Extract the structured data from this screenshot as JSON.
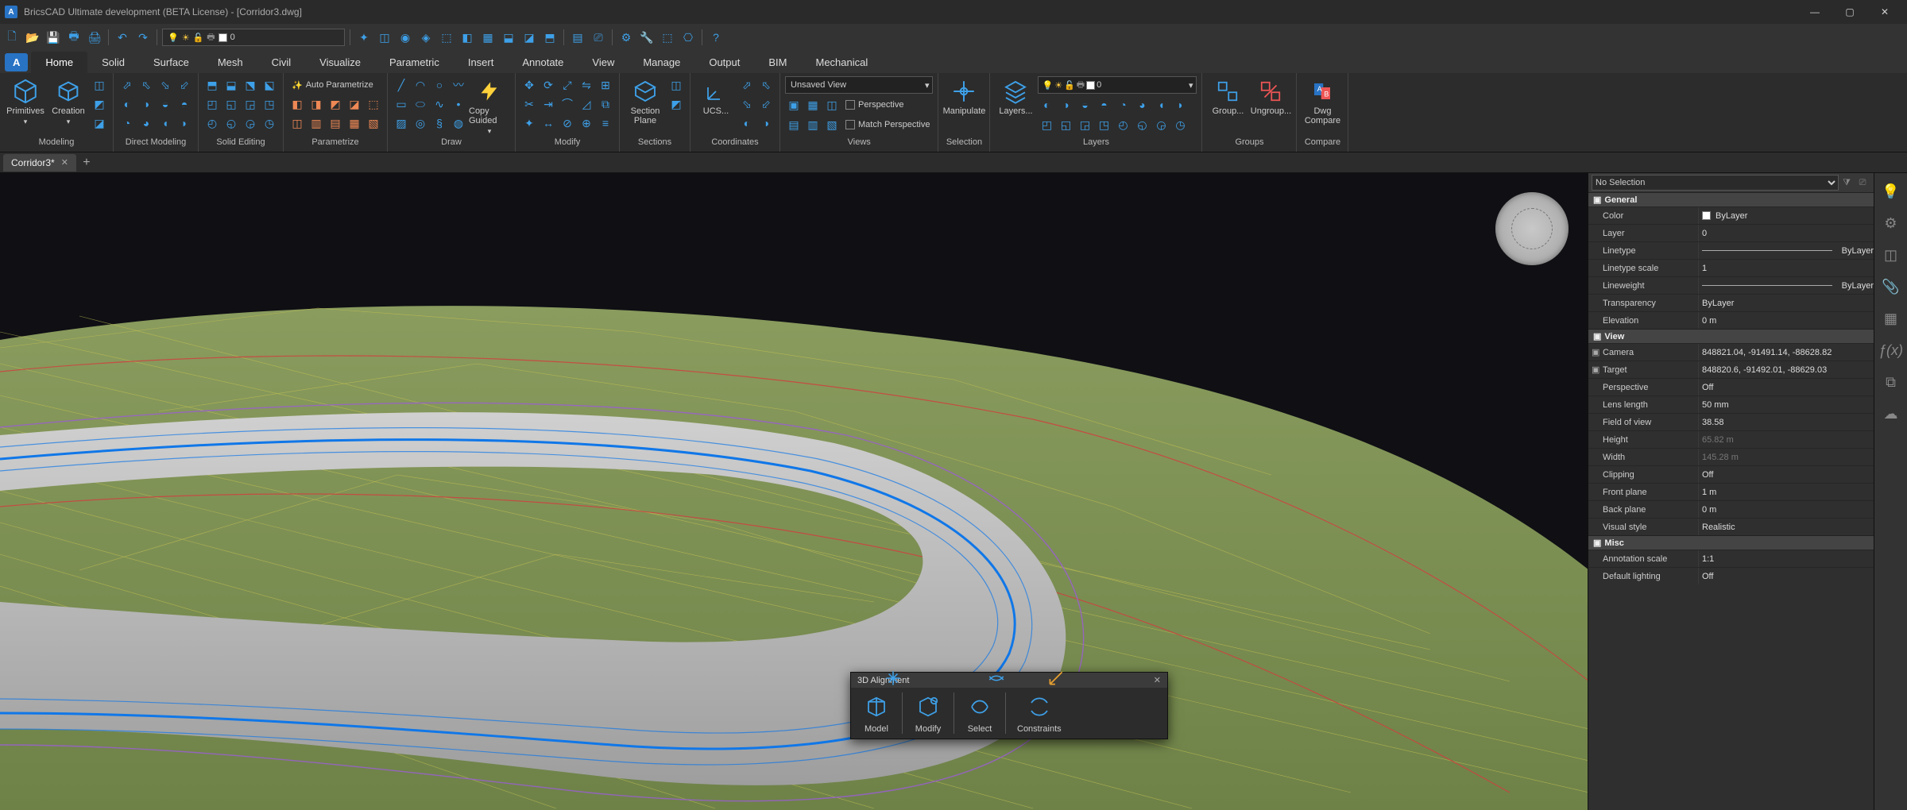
{
  "app": {
    "title": "BricsCAD Ultimate development (BETA License) - [Corridor3.dwg]"
  },
  "quickLayer": "0",
  "tabs": [
    "Home",
    "Solid",
    "Surface",
    "Mesh",
    "Civil",
    "Visualize",
    "Parametric",
    "Insert",
    "Annotate",
    "View",
    "Manage",
    "Output",
    "BIM",
    "Mechanical"
  ],
  "activeTab": "Home",
  "panels": {
    "modeling": {
      "label": "Modeling",
      "primitives": "Primitives",
      "creation": "Creation"
    },
    "directModeling": {
      "label": "Direct Modeling"
    },
    "solidEditing": {
      "label": "Solid Editing"
    },
    "parametrize": {
      "label": "Parametrize",
      "auto": "Auto Parametrize"
    },
    "draw": {
      "label": "Draw",
      "copyGuided": "Copy Guided"
    },
    "modify": {
      "label": "Modify"
    },
    "sections": {
      "label": "Sections",
      "sectionPlane": "Section Plane"
    },
    "coordinates": {
      "label": "Coordinates",
      "ucs": "UCS..."
    },
    "views": {
      "label": "Views",
      "unsaved": "Unsaved View",
      "persp": "Perspective",
      "matchPersp": "Match Perspective"
    },
    "selection": {
      "label": "Selection",
      "manipulate": "Manipulate"
    },
    "layers": {
      "label": "Layers",
      "layersBtn": "Layers...",
      "current": "0"
    },
    "groups": {
      "label": "Groups",
      "group": "Group...",
      "ungroup": "Ungroup..."
    },
    "compare": {
      "label": "Compare",
      "dwg": "Dwg Compare"
    }
  },
  "fileTab": "Corridor3*",
  "floating": {
    "title": "3D Alignment",
    "items": [
      "Model",
      "Modify",
      "Select",
      "Constraints"
    ]
  },
  "props": {
    "selector": "No Selection",
    "sections": {
      "general": "General",
      "view": "View",
      "misc": "Misc"
    },
    "rows": {
      "color": {
        "k": "Color",
        "v": "ByLayer"
      },
      "layer": {
        "k": "Layer",
        "v": "0"
      },
      "linetype": {
        "k": "Linetype",
        "v": "ByLayer"
      },
      "ltscale": {
        "k": "Linetype scale",
        "v": "1"
      },
      "lineweight": {
        "k": "Lineweight",
        "v": "ByLayer"
      },
      "transparency": {
        "k": "Transparency",
        "v": "ByLayer"
      },
      "elevation": {
        "k": "Elevation",
        "v": "0 m"
      },
      "camera": {
        "k": "Camera",
        "v": "848821.04, -91491.14, -88628.82"
      },
      "target": {
        "k": "Target",
        "v": "848820.6, -91492.01, -88629.03"
      },
      "perspective": {
        "k": "Perspective",
        "v": "Off"
      },
      "lens": {
        "k": "Lens length",
        "v": "50 mm"
      },
      "fov": {
        "k": "Field of view",
        "v": "38.58"
      },
      "height": {
        "k": "Height",
        "v": "65.82 m"
      },
      "width": {
        "k": "Width",
        "v": "145.28 m"
      },
      "clipping": {
        "k": "Clipping",
        "v": "Off"
      },
      "front": {
        "k": "Front plane",
        "v": "1 m"
      },
      "back": {
        "k": "Back plane",
        "v": "0 m"
      },
      "vstyle": {
        "k": "Visual style",
        "v": "Realistic"
      },
      "ascale": {
        "k": "Annotation scale",
        "v": "1:1"
      },
      "dlight": {
        "k": "Default lighting",
        "v": "Off"
      }
    }
  }
}
